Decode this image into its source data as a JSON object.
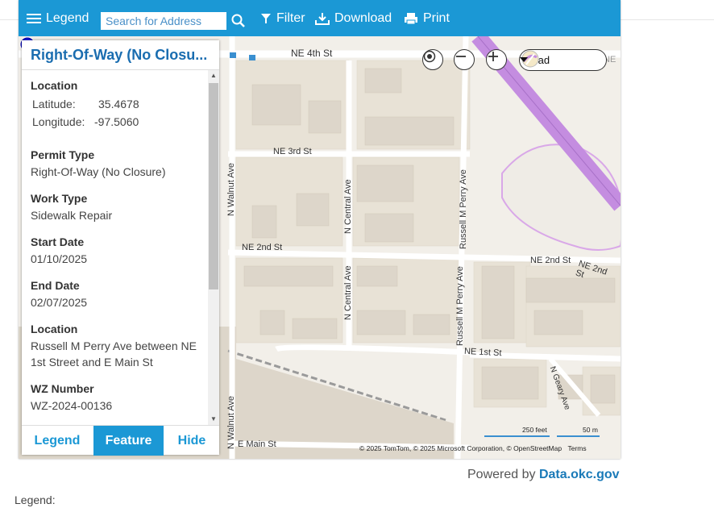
{
  "toolbar": {
    "legend_label": "Legend",
    "search_placeholder": "Search for Address",
    "filter_label": "Filter",
    "download_label": "Download",
    "print_label": "Print"
  },
  "map": {
    "basemap_select": "Road",
    "streets": {
      "ne_4th": "NE 4th St",
      "ne_3rd": "NE 3rd St",
      "ne_2nd_a": "NE 2nd St",
      "ne_2nd_b": "NE 2nd St",
      "ne_2nd_c": "NE 2nd St",
      "ne_1st": "NE 1st St",
      "e_main": "E Main St",
      "walnut_a": "N Walnut Ave",
      "walnut_b": "N Walnut Ave",
      "central_a": "N Central Ave",
      "central_b": "N Central Ave",
      "perry_a": "Russell M Perry Ave",
      "perry_b": "Russell M Perry Ave",
      "geary": "N Geary Ave",
      "ne_partial": "NE"
    },
    "scale": {
      "feet": "250 feet",
      "meters": "50 m"
    },
    "copyright": "© 2025 TomTom, © 2025 Microsoft Corporation, © OpenStreetMap",
    "terms": "Terms",
    "colors": {
      "highway": "#c48de0",
      "marker": "#1a1ad8",
      "toolbar": "#1b98d5"
    }
  },
  "panel": {
    "title": "Right-Of-Way (No Closu...",
    "location_heading": "Location",
    "latitude_label": "Latitude:",
    "latitude_value": "35.4678",
    "longitude_label": "Longitude:",
    "longitude_value": "-97.5060",
    "permit_type_heading": "Permit Type",
    "permit_type_value": "Right-Of-Way (No Closure)",
    "work_type_heading": "Work Type",
    "work_type_value": "Sidewalk Repair",
    "start_date_heading": "Start Date",
    "start_date_value": "01/10/2025",
    "end_date_heading": "End Date",
    "end_date_value": "02/07/2025",
    "location2_heading": "Location",
    "location2_line1": "Russell M Perry Ave between NE",
    "location2_line2": "1st Street and E Main St",
    "wz_heading": "WZ Number",
    "wz_value": "WZ-2024-00136",
    "tabs": {
      "legend": "Legend",
      "feature": "Feature",
      "hide": "Hide"
    }
  },
  "footer": {
    "powered_by": "Powered by",
    "site_link": "Data.okc.gov",
    "legend_label": "Legend:"
  }
}
